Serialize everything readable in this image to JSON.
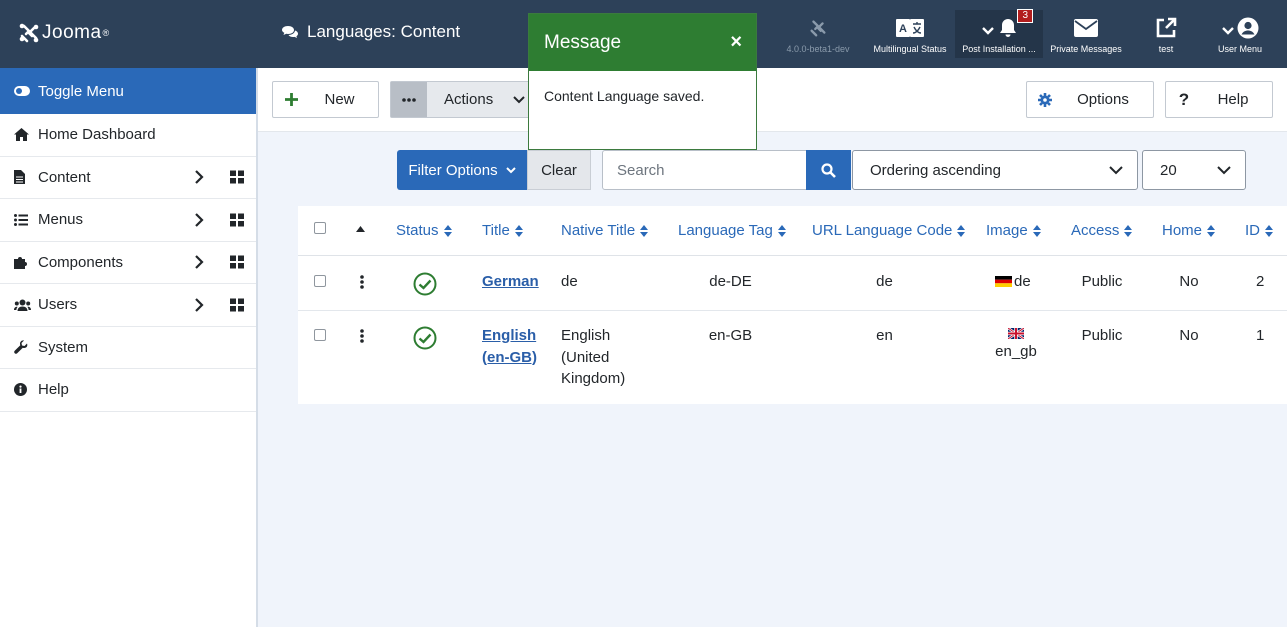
{
  "header": {
    "logo_text": "Jooma",
    "page_title": "Languages: Content",
    "version": "4.0.0-beta1-dev",
    "items": [
      {
        "label": "Multilingual Status"
      },
      {
        "label": "Post Installation ...",
        "badge": "3"
      },
      {
        "label": "Private Messages"
      },
      {
        "label": "test"
      },
      {
        "label": "User Menu"
      }
    ]
  },
  "sidebar": {
    "items": [
      {
        "label": "Toggle Menu",
        "icon": "toggle-icon"
      },
      {
        "label": "Home Dashboard",
        "icon": "home-icon"
      },
      {
        "label": "Content",
        "icon": "file-icon"
      },
      {
        "label": "Menus",
        "icon": "list-icon"
      },
      {
        "label": "Components",
        "icon": "puzzle-icon"
      },
      {
        "label": "Users",
        "icon": "users-icon"
      },
      {
        "label": "System",
        "icon": "wrench-icon"
      },
      {
        "label": "Help",
        "icon": "info-icon"
      }
    ]
  },
  "toolbar": {
    "new_label": "New",
    "actions_label": "Actions",
    "options_label": "Options",
    "help_label": "Help"
  },
  "message": {
    "title": "Message",
    "close": "×",
    "text": "Content Language saved."
  },
  "filters": {
    "filter_options_label": "Filter Options",
    "clear_label": "Clear",
    "search_placeholder": "Search",
    "ordering_value": "Ordering ascending",
    "limit_value": "20"
  },
  "table": {
    "headers": [
      "Status",
      "Title",
      "Native Title",
      "Language Tag",
      "URL Language Code",
      "Image",
      "Access",
      "Home",
      "ID"
    ],
    "rows": [
      {
        "title": "German",
        "native": "de",
        "tag": "de-DE",
        "url_code": "de",
        "image": "de",
        "access": "Public",
        "home": "No",
        "id": "2"
      },
      {
        "title_l1": "English",
        "title_l2": "(en-GB)",
        "native_l1": "English",
        "native_l2": "(United",
        "native_l3": "Kingdom)",
        "tag": "en-GB",
        "url_code": "en",
        "image": "en_gb",
        "access": "Public",
        "home": "No",
        "id": "1"
      }
    ]
  },
  "colors": {
    "header_bg": "#2d4159",
    "primary": "#2a69b8",
    "success": "#2e7d32",
    "badge": "#b21e1e"
  }
}
